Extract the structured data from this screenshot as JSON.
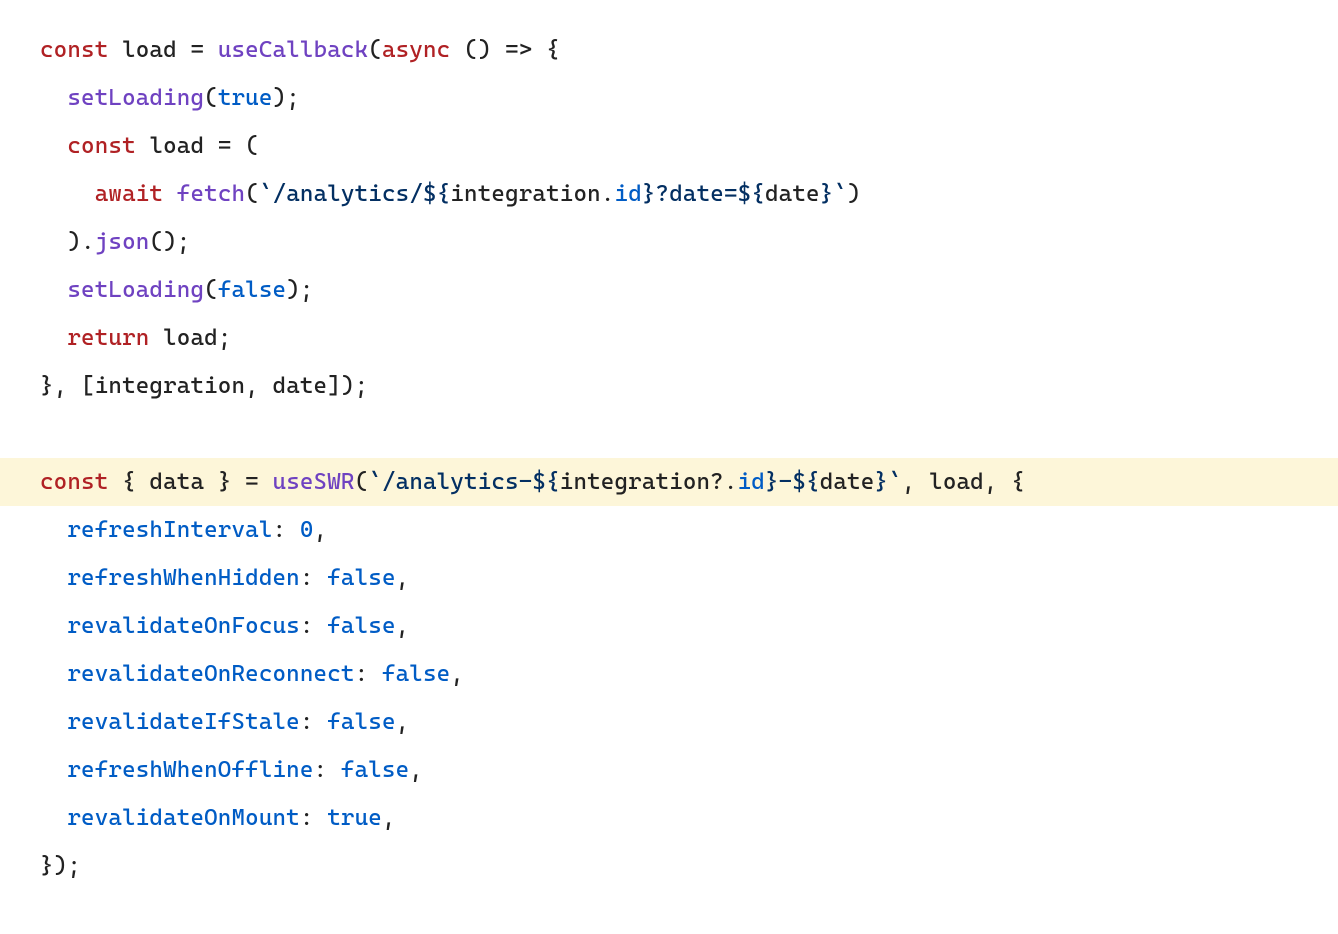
{
  "code": {
    "highlighted_line_index": 9,
    "lines": [
      [
        {
          "cls": "tok-kw",
          "key": "l0.t0"
        },
        {
          "cls": "tok-punct",
          "key": "l0.t1"
        },
        {
          "cls": "tok-ident",
          "key": "l0.t2"
        },
        {
          "cls": "tok-punct",
          "key": "l0.t3"
        },
        {
          "cls": "tok-func",
          "key": "l0.t4"
        },
        {
          "cls": "tok-punct",
          "key": "l0.t5"
        },
        {
          "cls": "tok-kw",
          "key": "l0.t6"
        },
        {
          "cls": "tok-punct",
          "key": "l0.t7"
        },
        {
          "cls": "tok-punct",
          "key": "l0.t8"
        },
        {
          "cls": "tok-punct",
          "key": "l0.t9"
        }
      ],
      [
        {
          "cls": "tok-punct",
          "key": "l1.t0"
        },
        {
          "cls": "tok-func",
          "key": "l1.t1"
        },
        {
          "cls": "tok-punct",
          "key": "l1.t2"
        },
        {
          "cls": "tok-bool",
          "key": "l1.t3"
        },
        {
          "cls": "tok-punct",
          "key": "l1.t4"
        }
      ],
      [
        {
          "cls": "tok-punct",
          "key": "l2.t0"
        },
        {
          "cls": "tok-kw",
          "key": "l2.t1"
        },
        {
          "cls": "tok-punct",
          "key": "l2.t2"
        },
        {
          "cls": "tok-ident",
          "key": "l2.t3"
        },
        {
          "cls": "tok-punct",
          "key": "l2.t4"
        }
      ],
      [
        {
          "cls": "tok-punct",
          "key": "l3.t0"
        },
        {
          "cls": "tok-kw",
          "key": "l3.t1"
        },
        {
          "cls": "tok-punct",
          "key": "l3.t2"
        },
        {
          "cls": "tok-func",
          "key": "l3.t3"
        },
        {
          "cls": "tok-punct",
          "key": "l3.t4"
        },
        {
          "cls": "tok-strdel",
          "key": "l3.t5"
        },
        {
          "cls": "tok-str",
          "key": "l3.t6"
        },
        {
          "cls": "tok-strdel",
          "key": "l3.t7"
        },
        {
          "cls": "tok-ident",
          "key": "l3.t8"
        },
        {
          "cls": "tok-punct",
          "key": "l3.t9"
        },
        {
          "cls": "tok-prop",
          "key": "l3.t10"
        },
        {
          "cls": "tok-strdel",
          "key": "l3.t11"
        },
        {
          "cls": "tok-str",
          "key": "l3.t12"
        },
        {
          "cls": "tok-strdel",
          "key": "l3.t13"
        },
        {
          "cls": "tok-ident",
          "key": "l3.t14"
        },
        {
          "cls": "tok-strdel",
          "key": "l3.t15"
        },
        {
          "cls": "tok-strdel",
          "key": "l3.t16"
        },
        {
          "cls": "tok-punct",
          "key": "l3.t17"
        }
      ],
      [
        {
          "cls": "tok-punct",
          "key": "l4.t0"
        },
        {
          "cls": "tok-punct",
          "key": "l4.t1"
        },
        {
          "cls": "tok-func",
          "key": "l4.t2"
        },
        {
          "cls": "tok-punct",
          "key": "l4.t3"
        }
      ],
      [
        {
          "cls": "tok-punct",
          "key": "l5.t0"
        },
        {
          "cls": "tok-func",
          "key": "l5.t1"
        },
        {
          "cls": "tok-punct",
          "key": "l5.t2"
        },
        {
          "cls": "tok-bool",
          "key": "l5.t3"
        },
        {
          "cls": "tok-punct",
          "key": "l5.t4"
        }
      ],
      [
        {
          "cls": "tok-punct",
          "key": "l6.t0"
        },
        {
          "cls": "tok-kw",
          "key": "l6.t1"
        },
        {
          "cls": "tok-punct",
          "key": "l6.t2"
        },
        {
          "cls": "tok-ident",
          "key": "l6.t3"
        },
        {
          "cls": "tok-punct",
          "key": "l6.t4"
        }
      ],
      [
        {
          "cls": "tok-punct",
          "key": "l7.t0"
        },
        {
          "cls": "tok-ident",
          "key": "l7.t1"
        },
        {
          "cls": "tok-punct",
          "key": "l7.t2"
        },
        {
          "cls": "tok-ident",
          "key": "l7.t3"
        },
        {
          "cls": "tok-punct",
          "key": "l7.t4"
        }
      ],
      [
        {
          "cls": "tok-punct",
          "key": "l8.t0"
        }
      ],
      [
        {
          "cls": "tok-kw",
          "key": "l9.t0"
        },
        {
          "cls": "tok-punct",
          "key": "l9.t1"
        },
        {
          "cls": "tok-ident",
          "key": "l9.t2"
        },
        {
          "cls": "tok-punct",
          "key": "l9.t3"
        },
        {
          "cls": "tok-func",
          "key": "l9.t4"
        },
        {
          "cls": "tok-punct",
          "key": "l9.t5"
        },
        {
          "cls": "tok-strdel",
          "key": "l9.t6"
        },
        {
          "cls": "tok-str",
          "key": "l9.t7"
        },
        {
          "cls": "tok-strdel",
          "key": "l9.t8"
        },
        {
          "cls": "tok-ident",
          "key": "l9.t9"
        },
        {
          "cls": "tok-punct",
          "key": "l9.t10"
        },
        {
          "cls": "tok-prop",
          "key": "l9.t11"
        },
        {
          "cls": "tok-strdel",
          "key": "l9.t12"
        },
        {
          "cls": "tok-str",
          "key": "l9.t13"
        },
        {
          "cls": "tok-strdel",
          "key": "l9.t14"
        },
        {
          "cls": "tok-ident",
          "key": "l9.t15"
        },
        {
          "cls": "tok-strdel",
          "key": "l9.t16"
        },
        {
          "cls": "tok-strdel",
          "key": "l9.t17"
        },
        {
          "cls": "tok-punct",
          "key": "l9.t18"
        },
        {
          "cls": "tok-ident",
          "key": "l9.t19"
        },
        {
          "cls": "tok-punct",
          "key": "l9.t20"
        }
      ],
      [
        {
          "cls": "tok-punct",
          "key": "l10.t0"
        },
        {
          "cls": "tok-prop",
          "key": "l10.t1"
        },
        {
          "cls": "tok-punct",
          "key": "l10.t2"
        },
        {
          "cls": "tok-num",
          "key": "l10.t3"
        },
        {
          "cls": "tok-punct",
          "key": "l10.t4"
        }
      ],
      [
        {
          "cls": "tok-punct",
          "key": "l11.t0"
        },
        {
          "cls": "tok-prop",
          "key": "l11.t1"
        },
        {
          "cls": "tok-punct",
          "key": "l11.t2"
        },
        {
          "cls": "tok-bool",
          "key": "l11.t3"
        },
        {
          "cls": "tok-punct",
          "key": "l11.t4"
        }
      ],
      [
        {
          "cls": "tok-punct",
          "key": "l12.t0"
        },
        {
          "cls": "tok-prop",
          "key": "l12.t1"
        },
        {
          "cls": "tok-punct",
          "key": "l12.t2"
        },
        {
          "cls": "tok-bool",
          "key": "l12.t3"
        },
        {
          "cls": "tok-punct",
          "key": "l12.t4"
        }
      ],
      [
        {
          "cls": "tok-punct",
          "key": "l13.t0"
        },
        {
          "cls": "tok-prop",
          "key": "l13.t1"
        },
        {
          "cls": "tok-punct",
          "key": "l13.t2"
        },
        {
          "cls": "tok-bool",
          "key": "l13.t3"
        },
        {
          "cls": "tok-punct",
          "key": "l13.t4"
        }
      ],
      [
        {
          "cls": "tok-punct",
          "key": "l14.t0"
        },
        {
          "cls": "tok-prop",
          "key": "l14.t1"
        },
        {
          "cls": "tok-punct",
          "key": "l14.t2"
        },
        {
          "cls": "tok-bool",
          "key": "l14.t3"
        },
        {
          "cls": "tok-punct",
          "key": "l14.t4"
        }
      ],
      [
        {
          "cls": "tok-punct",
          "key": "l15.t0"
        },
        {
          "cls": "tok-prop",
          "key": "l15.t1"
        },
        {
          "cls": "tok-punct",
          "key": "l15.t2"
        },
        {
          "cls": "tok-bool",
          "key": "l15.t3"
        },
        {
          "cls": "tok-punct",
          "key": "l15.t4"
        }
      ],
      [
        {
          "cls": "tok-punct",
          "key": "l16.t0"
        },
        {
          "cls": "tok-prop",
          "key": "l16.t1"
        },
        {
          "cls": "tok-punct",
          "key": "l16.t2"
        },
        {
          "cls": "tok-bool",
          "key": "l16.t3"
        },
        {
          "cls": "tok-punct",
          "key": "l16.t4"
        }
      ],
      [
        {
          "cls": "tok-punct",
          "key": "l17.t0"
        }
      ]
    ],
    "tokens": {
      "l0": {
        "t0": "const",
        "t1": " ",
        "t2": "load",
        "t3": " = ",
        "t4": "useCallback",
        "t5": "(",
        "t6": "async",
        "t7": " () ",
        "t8": "=>",
        "t9": " {"
      },
      "l1": {
        "t0": "  ",
        "t1": "setLoading",
        "t2": "(",
        "t3": "true",
        "t4": ");"
      },
      "l2": {
        "t0": "  ",
        "t1": "const",
        "t2": " ",
        "t3": "load",
        "t4": " = ("
      },
      "l3": {
        "t0": "    ",
        "t1": "await",
        "t2": " ",
        "t3": "fetch",
        "t4": "(",
        "t5": "`",
        "t6": "/analytics/",
        "t7": "${",
        "t8": "integration",
        "t9": ".",
        "t10": "id",
        "t11": "}",
        "t12": "?date=",
        "t13": "${",
        "t14": "date",
        "t15": "}",
        "t16": "`",
        "t17": ")"
      },
      "l4": {
        "t0": "  ).",
        "t1": "",
        "t2": "json",
        "t3": "();"
      },
      "l5": {
        "t0": "  ",
        "t1": "setLoading",
        "t2": "(",
        "t3": "false",
        "t4": ");"
      },
      "l6": {
        "t0": "  ",
        "t1": "return",
        "t2": " ",
        "t3": "load",
        "t4": ";"
      },
      "l7": {
        "t0": "}, [",
        "t1": "integration",
        "t2": ", ",
        "t3": "date",
        "t4": "]);"
      },
      "l8": {
        "t0": ""
      },
      "l9": {
        "t0": "const",
        "t1": " { ",
        "t2": "data",
        "t3": " } = ",
        "t4": "useSWR",
        "t5": "(",
        "t6": "`",
        "t7": "/analytics-",
        "t8": "${",
        "t9": "integration",
        "t10": "?.",
        "t11": "id",
        "t12": "}",
        "t13": "-",
        "t14": "${",
        "t15": "date",
        "t16": "}",
        "t17": "`",
        "t18": ", ",
        "t19": "load",
        "t20": ", {"
      },
      "l10": {
        "t0": "  ",
        "t1": "refreshInterval",
        "t2": ": ",
        "t3": "0",
        "t4": ","
      },
      "l11": {
        "t0": "  ",
        "t1": "refreshWhenHidden",
        "t2": ": ",
        "t3": "false",
        "t4": ","
      },
      "l12": {
        "t0": "  ",
        "t1": "revalidateOnFocus",
        "t2": ": ",
        "t3": "false",
        "t4": ","
      },
      "l13": {
        "t0": "  ",
        "t1": "revalidateOnReconnect",
        "t2": ": ",
        "t3": "false",
        "t4": ","
      },
      "l14": {
        "t0": "  ",
        "t1": "revalidateIfStale",
        "t2": ": ",
        "t3": "false",
        "t4": ","
      },
      "l15": {
        "t0": "  ",
        "t1": "refreshWhenOffline",
        "t2": ": ",
        "t3": "false",
        "t4": ","
      },
      "l16": {
        "t0": "  ",
        "t1": "revalidateOnMount",
        "t2": ": ",
        "t3": "true",
        "t4": ","
      },
      "l17": {
        "t0": "});"
      }
    }
  }
}
